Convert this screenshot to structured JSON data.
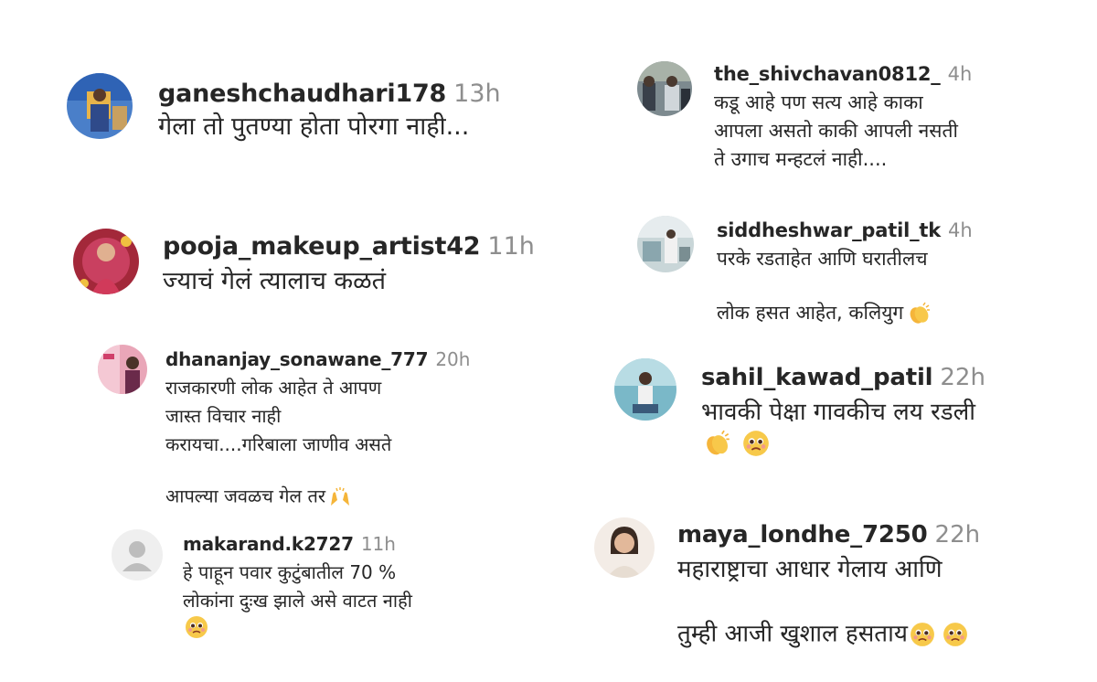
{
  "comments": [
    {
      "username": "ganeshchaudhari178",
      "time": "13h",
      "text": "गेला तो पुतण्या होता पोरगा नाही..."
    },
    {
      "username": "the_shivchavan0812_",
      "time": "4h",
      "text": "कडू आहे पण सत्य आहे काका\nआपला असतो काकी आपली नसती\nते उगाच मन्हटलं नाही...."
    },
    {
      "username": "pooja_makeup_artist42",
      "time": "11h",
      "text": "ज्याचं गेलं त्यालाच कळतं"
    },
    {
      "username": "siddheshwar_patil_tk",
      "time": "4h",
      "text": "परके रडताहेत आणि घरातीलच\nलोक हसत आहेत, कलियुग",
      "emoji": "clapping-hands-icon"
    },
    {
      "username": "dhananjay_sonawane_777",
      "time": "20h",
      "text": "राजकारणी लोक आहेत ते आपण\nजास्त विचार नाही\nकरायचा....गरिबाला जाणीव असते\nआपल्या जवळच गेल तर",
      "emoji": "raising-hands-icon"
    },
    {
      "username": "sahil_kawad_patil",
      "time": "22h",
      "text": "भावकी पेक्षा गावकीच लय रडली",
      "emoji": [
        "clapping-hands-icon",
        "pleading-face-icon"
      ]
    },
    {
      "username": "makarand.k2727",
      "time": "11h",
      "text": "हे पाहून पवार कुटुंबातील 70 %\nलोकांना दुःख झाले असे वाटत नाही",
      "emoji": "pleading-face-icon"
    },
    {
      "username": "maya_londhe_7250",
      "time": "22h",
      "text": "महाराष्ट्राचा आधार गेलाय आणि\nतुम्ही आजी खुशाल हसताय",
      "emoji": [
        "pleading-face-icon",
        "pleading-face-icon"
      ]
    }
  ],
  "colors": {
    "username": "#262626",
    "timestamp": "#8e8e8e",
    "text": "#262626",
    "background": "#ffffff"
  }
}
